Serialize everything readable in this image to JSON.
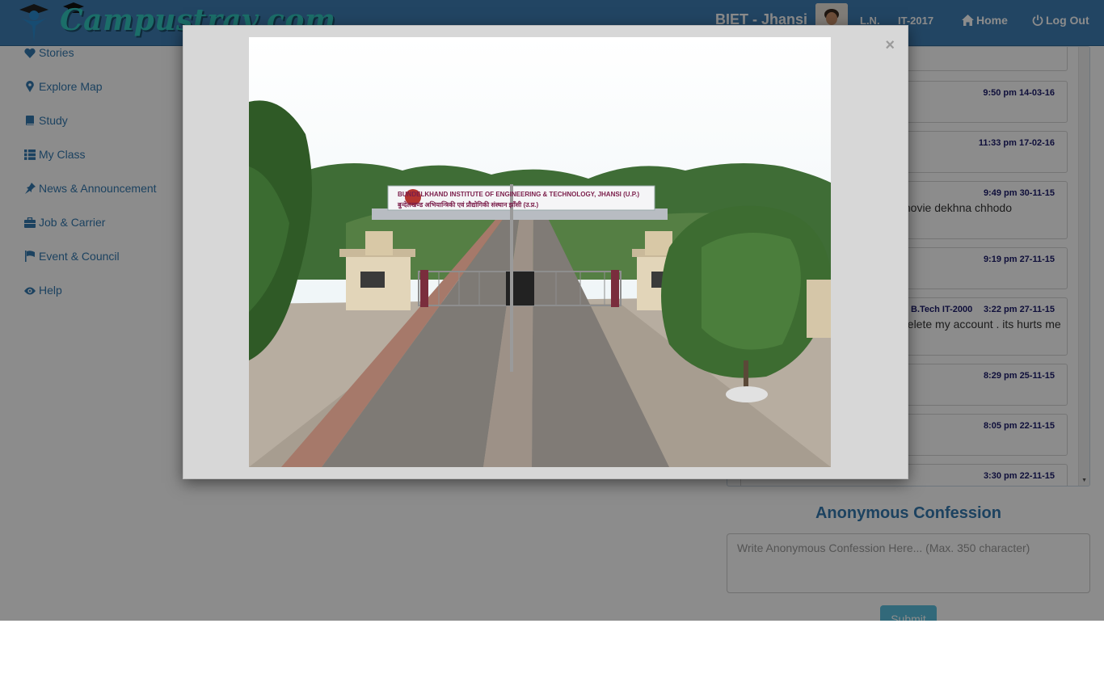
{
  "header": {
    "logo_text": "Campustrav.com",
    "college": "BIET - Jhansi",
    "user": "L.N.",
    "batch": "IT-2017",
    "home_label": "Home",
    "logout_label": "Log Out"
  },
  "sidebar": {
    "items": [
      {
        "label": "Stories",
        "icon": "heart-icon"
      },
      {
        "label": "Explore Map",
        "icon": "map-marker-icon"
      },
      {
        "label": "Study",
        "icon": "book-icon"
      },
      {
        "label": "My Class",
        "icon": "list-icon"
      },
      {
        "label": "News & Announcement",
        "icon": "pushpin-icon"
      },
      {
        "label": "Job & Carrier",
        "icon": "briefcase-icon"
      },
      {
        "label": "Event & Council",
        "icon": "flag-icon"
      },
      {
        "label": "Help",
        "icon": "eye-icon"
      }
    ]
  },
  "messages": [
    {
      "time": "9:50 pm 14-03-16",
      "sender": "",
      "text": ""
    },
    {
      "time": "11:33 pm 17-02-16",
      "sender": "",
      "text": ""
    },
    {
      "time": "9:49 pm 30-11-15",
      "sender": "",
      "text": "movie dekhna chhodo"
    },
    {
      "time": "9:19 pm 27-11-15",
      "sender": "",
      "text": ""
    },
    {
      "time": "3:22 pm 27-11-15",
      "sender": "B.Tech IT-2000",
      "text": "delete my account . its hurts me"
    },
    {
      "time": "8:29 pm 25-11-15",
      "sender": "",
      "text": ""
    },
    {
      "time": "8:05 pm 22-11-15",
      "sender": "",
      "text": ""
    },
    {
      "time": "3:30 pm 22-11-15",
      "sender": "",
      "text": ""
    }
  ],
  "confession": {
    "title": "Anonymous Confession",
    "placeholder": "Write Anonymous Confession Here... (Max. 350 character)",
    "submit_label": "Submit"
  },
  "modal": {
    "close_label": "×",
    "photo_sign_en": "BUNDELKHAND INSTITUTE OF ENGINEERING & TECHNOLOGY, JHANSI (U.P.)",
    "photo_sign_hi": "बुन्देलखण्ड अभियान्त्रिकी एवं प्रौद्योगिकी संस्थान झाँसी (उ.प्र.)"
  },
  "colors": {
    "navbar": "#3e7eb4",
    "link": "#3479b0",
    "submit": "#5bc0de",
    "timestamp": "#1b1b6a"
  }
}
